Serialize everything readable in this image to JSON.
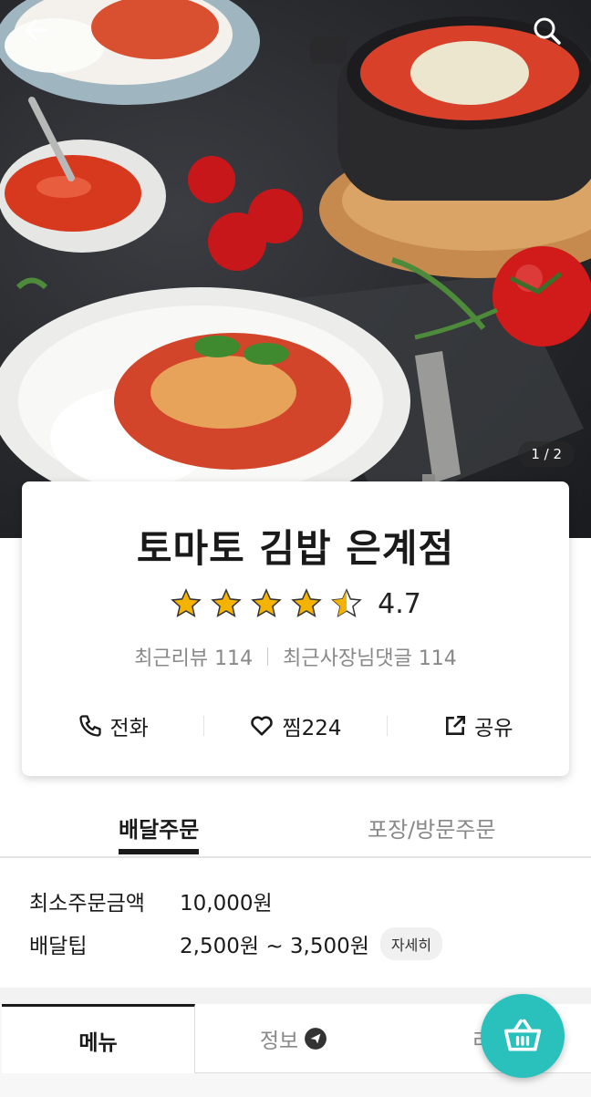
{
  "hero": {
    "page_indicator": "1 / 2",
    "back_icon": "arrow-left-icon",
    "search_icon": "search-icon"
  },
  "store": {
    "name": "토마토 김밥 은계점",
    "rating": 4.7,
    "rating_text": "4.7",
    "recent_reviews": "최근리뷰 114",
    "owner_replies": "최근사장님댓글 114",
    "actions": {
      "call": "전화",
      "favorite": "찜224",
      "share": "공유"
    }
  },
  "order_tabs": {
    "delivery": "배달주문",
    "pickup": "포장/방문주문"
  },
  "order_info": {
    "min_order_label": "최소주문금액",
    "min_order_value": "10,000원",
    "tip_label": "배달팁",
    "tip_value": "2,500원 ~ 3,500원",
    "detail_button": "자세히"
  },
  "bottom_tabs": {
    "menu": "메뉴",
    "info": "정보",
    "review": "리"
  },
  "colors": {
    "accent": "#2ac1bc",
    "star": "#f5b301"
  }
}
